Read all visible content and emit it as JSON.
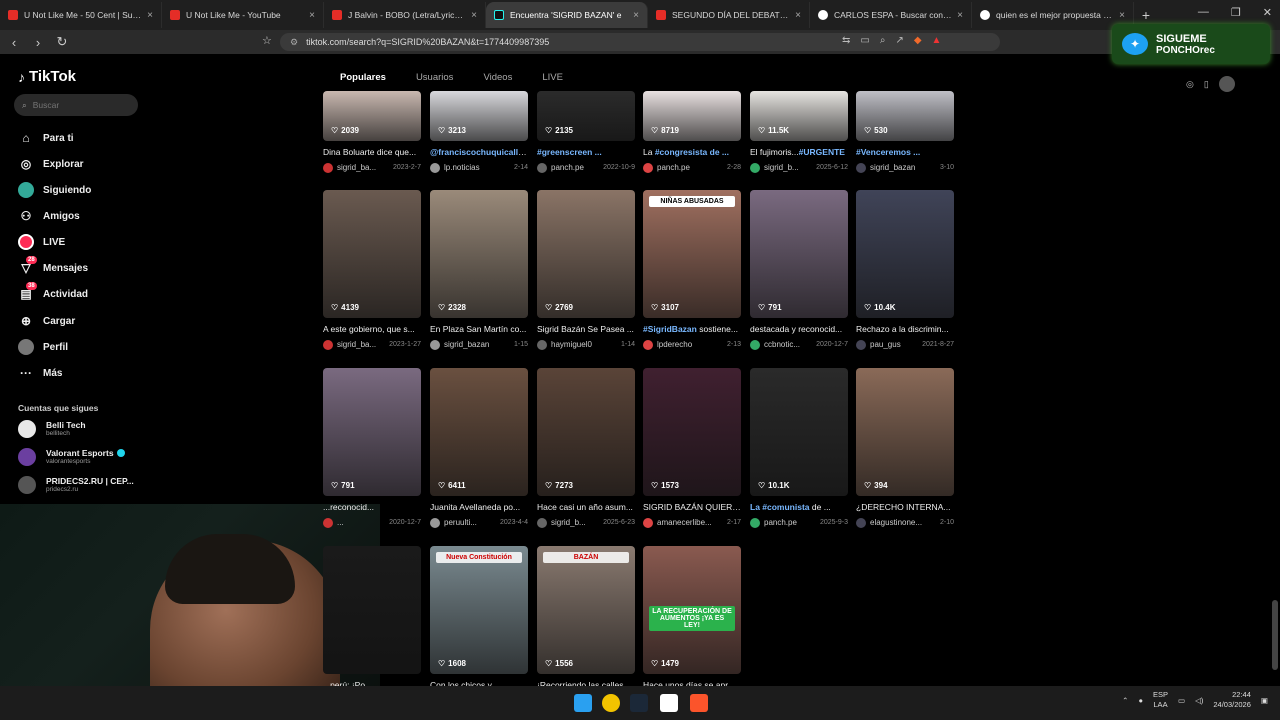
{
  "browser": {
    "tabs": [
      {
        "label": "U Not Like Me - 50 Cent | Subtitulad",
        "icon": "youtube-icon",
        "active": false
      },
      {
        "label": "U Not Like Me - YouTube",
        "icon": "youtube-icon",
        "active": false
      },
      {
        "label": "J Balvin - BOBO (Letra/Lyrics) - YouT",
        "icon": "youtube-icon",
        "active": false
      },
      {
        "label": "Encuentra 'SIGRID BAZAN' e",
        "icon": "tiktok-icon",
        "active": true
      },
      {
        "label": "SEGUNDO DÍA DEL DEBATE PRES",
        "icon": "youtube-icon",
        "active": false
      },
      {
        "label": "CARLOS ESPA - Buscar con Google",
        "icon": "google-icon",
        "active": false
      },
      {
        "label": "quien es el mejor propuesta para el",
        "icon": "google-icon",
        "active": false
      }
    ],
    "url": "tiktok.com/search?q=SIGRID%20BAZAN&t=1774409987395"
  },
  "overlay": {
    "line1": "SIGUEME",
    "line2": "PONCHOrec"
  },
  "sidebar": {
    "logo": "TikTok",
    "search_placeholder": "Buscar",
    "nav": [
      {
        "label": "Para ti",
        "icon": "home-icon"
      },
      {
        "label": "Explorar",
        "icon": "compass-icon"
      },
      {
        "label": "Siguiendo",
        "icon": "following-icon"
      },
      {
        "label": "Amigos",
        "icon": "friends-icon"
      },
      {
        "label": "LIVE",
        "icon": "live-icon"
      },
      {
        "label": "Mensajes",
        "icon": "messages-icon",
        "badge": "28"
      },
      {
        "label": "Actividad",
        "icon": "activity-icon",
        "badge": "38"
      },
      {
        "label": "Cargar",
        "icon": "upload-icon"
      },
      {
        "label": "Perfil",
        "icon": "profile-icon"
      },
      {
        "label": "Más",
        "icon": "more-icon"
      }
    ],
    "following_title": "Cuentas que sigues",
    "following": [
      {
        "name": "Belli Tech",
        "handle": "bellitech",
        "color": "#e8e8e8"
      },
      {
        "name": "Valorant Esports",
        "handle": "valorantesports",
        "verified": true,
        "color": "#6b3fa0"
      },
      {
        "name": "PRIDECS2.RU | CEP...",
        "handle": "pridecs2.ru",
        "color": "#555555"
      }
    ]
  },
  "tabs_top": [
    "Populares",
    "Usuarios",
    "Videos",
    "LIVE"
  ],
  "grid": {
    "row1": [
      {
        "count": "2039",
        "title": "Dina Boluarte dice que...",
        "hl": "",
        "author": "sigrid_ba...",
        "date": "2023-2-7",
        "color": "#c9b8b0"
      },
      {
        "count": "3213",
        "title": "",
        "hl": "@franciscochuquicallata",
        "author": "lp.noticias",
        "date": "2-14",
        "color": "#d8d8dc"
      },
      {
        "count": "2135",
        "title": "",
        "hl": "#greenscreen ...",
        "author": "panch.pe",
        "date": "2022-10-9",
        "color": "#2b2b2b"
      },
      {
        "count": "8719",
        "title": "La ",
        "hl": "#congresista de ...",
        "author": "panch.pe",
        "date": "2-28",
        "color": "#e8e0e0"
      },
      {
        "count": "11.5K",
        "title": "El fujimoris...",
        "hl": "#URGENTE ",
        "author": "sigrid_b...",
        "date": "2025-6-12",
        "color": "#e6e4e0"
      },
      {
        "count": "530",
        "title": "",
        "hl": "#Venceremos ...",
        "author": "sigrid_bazan",
        "date": "3-10",
        "color": "#bfbfc6"
      }
    ],
    "row2": [
      {
        "count": "4139",
        "title": "A este gobierno, que s...",
        "hl": "",
        "author": "sigrid_ba...",
        "date": "2023-1-27",
        "color": "#6a5a50"
      },
      {
        "count": "2328",
        "title": "En Plaza San Martín co...",
        "hl": "",
        "author": "sigrid_bazan",
        "date": "1-15",
        "color": "#9a8a7a"
      },
      {
        "count": "2769",
        "title": "Sigrid Bazán Se Pasea ...",
        "hl": "",
        "author": "haymiguel0",
        "date": "1-14",
        "color": "#8a7466"
      },
      {
        "count": "3107",
        "title": " sostiene...",
        "hl": "#SigridBazan",
        "author": "lpderecho",
        "date": "2-13",
        "color": "#a07060",
        "caption": "NIÑAS ABUSADAS"
      },
      {
        "count": "791",
        "title": "destacada y reconocid...",
        "hl": "",
        "author": "ccbnotic...",
        "date": "2020-12-7",
        "color": "#7a6a80"
      },
      {
        "count": "10.4K",
        "title": "Rechazo a la discrimin...",
        "hl": "",
        "author": "pau_gus",
        "date": "2021-8-27",
        "color": "#404458"
      }
    ],
    "row3": [
      {
        "count": "791",
        "title": "...reconocid...",
        "hl": "",
        "author": "...",
        "date": "2020-12-7",
        "color": "#7a6a80"
      },
      {
        "count": "6411",
        "title": "Juanita Avellaneda po...",
        "hl": "",
        "author": "peruulti...",
        "date": "2023-4-4",
        "color": "#6a5040"
      },
      {
        "count": "7273",
        "title": "Hace casi un año asum...",
        "hl": "",
        "author": "sigrid_b...",
        "date": "2025-6-23",
        "color": "#5a4438"
      },
      {
        "count": "1573",
        "title": "SIGRID BAZÁN QUIERE...",
        "hl": "",
        "author": "amanecerlibe...",
        "date": "2-17",
        "color": "#402030"
      },
      {
        "count": "10.1K",
        "title": " de ...",
        "hl": "La #comunista",
        "author": "panch.pe",
        "date": "2025-9-3",
        "color": "#2a2a2a"
      },
      {
        "count": "394",
        "title": "¿DERECHO INTERNA...",
        "hl": "",
        "author": "elagustinone...",
        "date": "2-10",
        "color": "#8a6a58"
      }
    ],
    "row4": [
      {
        "count": "",
        "title": "...perú: ¡Po...",
        "color": "#1a1a1a"
      },
      {
        "count": "1608",
        "title": "Con los chicos y...",
        "color": "#7a8a90",
        "caption": "Nueva Constitución"
      },
      {
        "count": "1556",
        "title": "¡Recorriendo las calles...",
        "color": "#8a7a70",
        "caption": "BAZÁN"
      },
      {
        "count": "1479",
        "title": "Hace unos días se apr...",
        "color": "#8a5a50",
        "caption": "LA RECUPERACIÓN DE AUMENTOS ¡YA ES LEY!"
      }
    ]
  },
  "taskbar": {
    "lang1": "ESP",
    "lang2": "LAA",
    "time": "22:44",
    "date": "24/03/2026"
  }
}
